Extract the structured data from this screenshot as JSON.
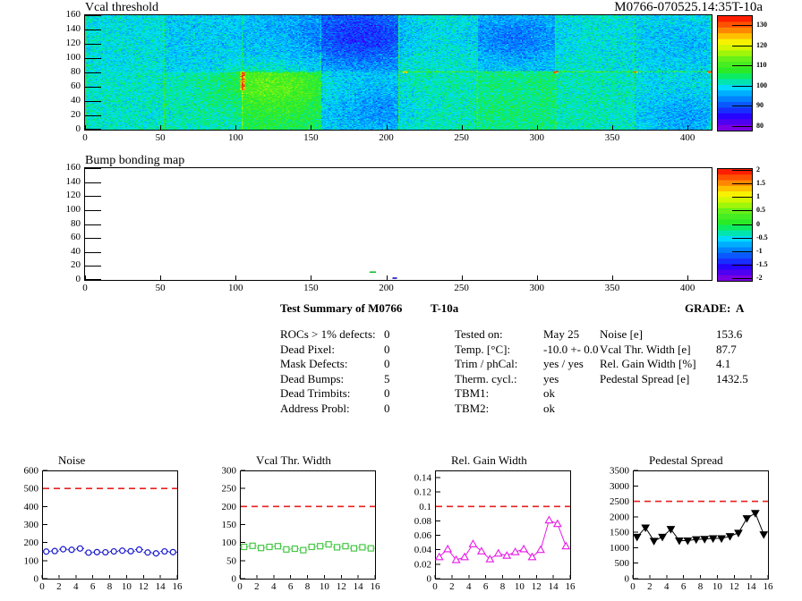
{
  "summary": {
    "title": "Test Summary of M0766",
    "module_type": "T-10a",
    "grade": "GRADE:  A",
    "columns": [
      {
        "rows": [
          [
            "ROCs > 1% defects:",
            "0"
          ],
          [
            "Dead Pixel:",
            "0"
          ],
          [
            "Mask Defects:",
            "0"
          ],
          [
            "Dead Bumps:",
            "5"
          ],
          [
            "Dead Trimbits:",
            "0"
          ],
          [
            "Address Probl:",
            "0"
          ]
        ]
      },
      {
        "rows": [
          [
            "Tested on:",
            "May 25"
          ],
          [
            "Temp. [°C]:",
            "-10.0 +- 0.0"
          ],
          [
            "Trim / phCal:",
            "yes / yes"
          ],
          [
            "Therm. cycl.:",
            "yes"
          ],
          [
            "TBM1:",
            "ok"
          ],
          [
            "TBM2:",
            "ok"
          ]
        ]
      },
      {
        "rows": [
          [
            "Noise [e]",
            "153.6"
          ],
          [
            "Vcal Thr. Width [e]",
            "87.7"
          ],
          [
            "Rel. Gain Width [%]",
            "4.1"
          ],
          [
            "Pedestal Spread [e]",
            "1432.5"
          ]
        ]
      }
    ]
  },
  "colors": {
    "cut": "#e62020",
    "frame": "#000000"
  },
  "chart_data": [
    {
      "type": "heatmap",
      "title": "Vcal threshold",
      "right_title": "M0766-070525.14:35T-10a",
      "x_ticks": [
        0,
        50,
        100,
        150,
        200,
        250,
        300,
        350,
        400
      ],
      "y_ticks": [
        0,
        20,
        40,
        60,
        80,
        100,
        120,
        140,
        160
      ],
      "x_max": 416,
      "y_max": 160,
      "z_labels": [
        "130",
        "120",
        "110",
        "100",
        "90",
        "80"
      ],
      "z_label_values": [
        130,
        120,
        110,
        100,
        90,
        80
      ],
      "z_scale": [
        78,
        135
      ],
      "base": 102,
      "sigma": 3.6,
      "roc_bias_top": [
        -2,
        -4,
        -5,
        -7,
        -1,
        -4,
        -1,
        -2
      ],
      "roc_bias_bottom": [
        -1,
        0,
        4,
        -4,
        0,
        2,
        0,
        -2
      ],
      "blobs": [
        {
          "x": 182,
          "y": 132,
          "r": 26,
          "a": -8
        },
        {
          "x": 285,
          "y": 128,
          "r": 22,
          "a": -6
        },
        {
          "x": 122,
          "y": 62,
          "r": 24,
          "a": 7
        },
        {
          "x": 398,
          "y": 18,
          "r": 22,
          "a": -5
        },
        {
          "x": 196,
          "y": 28,
          "r": 20,
          "a": -4
        },
        {
          "x": 395,
          "y": 120,
          "r": 30,
          "a": -3
        }
      ],
      "v_lines": [
        0,
        52,
        104,
        156,
        208,
        260,
        312,
        364,
        415
      ],
      "v_line_amp": 7,
      "h_line_y": 80,
      "h_line_x1": 100,
      "h_line_amp": 9,
      "red_spots": [
        {
          "x": 104,
          "y1": 55,
          "y2": 80,
          "a": 22
        },
        {
          "x": 212,
          "y1": 79,
          "y2": 81,
          "a": 24
        },
        {
          "x": 312,
          "y1": 79,
          "y2": 81,
          "a": 24
        },
        {
          "x": 365,
          "y1": 79,
          "y2": 81,
          "a": 22
        },
        {
          "x": 414,
          "y1": 79,
          "y2": 81,
          "a": 26
        }
      ]
    },
    {
      "type": "heatmap",
      "title": "Bump bonding map",
      "x_ticks": [
        0,
        50,
        100,
        150,
        200,
        250,
        300,
        350,
        400
      ],
      "y_ticks": [
        0,
        20,
        40,
        60,
        80,
        100,
        120,
        140,
        160
      ],
      "x_max": 416,
      "y_max": 160,
      "z_labels": [
        "2",
        "1.5",
        "1",
        "0.5",
        "0",
        "-0.5",
        "-1",
        "-1.5",
        "-2"
      ],
      "z_label_values": [
        2,
        1.5,
        1,
        0.5,
        0,
        -0.5,
        -1,
        -1.5,
        -2
      ],
      "z_scale": [
        -2.05,
        2.05
      ],
      "background": "#ffffff",
      "points": [
        {
          "x": 189,
          "y": 10,
          "color": "#00bb22",
          "w": 4,
          "h": 2
        },
        {
          "x": 204,
          "y": 1,
          "color": "#4040cc",
          "w": 3,
          "h": 3
        }
      ]
    },
    {
      "type": "scatter",
      "title": "Noise",
      "x": [
        0.5,
        1.5,
        2.5,
        3.5,
        4.5,
        5.5,
        6.5,
        7.5,
        8.5,
        9.5,
        10.5,
        11.5,
        12.5,
        13.5,
        14.5,
        15.5
      ],
      "y": [
        150,
        153,
        163,
        160,
        167,
        144,
        147,
        146,
        151,
        155,
        152,
        161,
        145,
        140,
        151,
        147
      ],
      "y_err": 12,
      "cut": 500,
      "ylim": [
        0,
        600
      ],
      "y_ticks": [
        0,
        100,
        200,
        300,
        400,
        500,
        600
      ],
      "y_tick_labels": [
        "0",
        "100",
        "200",
        "300",
        "400",
        "500",
        "600"
      ],
      "x_ticks": [
        0,
        2,
        4,
        6,
        8,
        10,
        12,
        14,
        16
      ],
      "x_tick_labels": [
        "0",
        "2",
        "4",
        "6",
        "8",
        "10",
        "12",
        "14",
        "16"
      ],
      "marker": "circle",
      "connect": false,
      "xerr": true,
      "color": "#1818cc"
    },
    {
      "type": "scatter",
      "title": "Vcal Thr. Width",
      "x": [
        0.5,
        1.5,
        2.5,
        3.5,
        4.5,
        5.5,
        6.5,
        7.5,
        8.5,
        9.5,
        10.5,
        11.5,
        12.5,
        13.5,
        14.5,
        15.5
      ],
      "y": [
        88,
        91,
        85,
        88,
        90,
        81,
        83,
        79,
        88,
        90,
        95,
        87,
        90,
        84,
        87,
        84
      ],
      "cut": 200,
      "ylim": [
        0,
        300
      ],
      "y_ticks": [
        0,
        50,
        100,
        150,
        200,
        250,
        300
      ],
      "y_tick_labels": [
        "0",
        "50",
        "100",
        "150",
        "200",
        "250",
        "300"
      ],
      "x_ticks": [
        0,
        2,
        4,
        6,
        8,
        10,
        12,
        14,
        16
      ],
      "x_tick_labels": [
        "0",
        "2",
        "4",
        "6",
        "8",
        "10",
        "12",
        "14",
        "16"
      ],
      "marker": "square",
      "connect": false,
      "xerr": true,
      "color": "#46c846"
    },
    {
      "type": "line",
      "title": "Rel. Gain Width",
      "x": [
        0.5,
        1.5,
        2.5,
        3.5,
        4.5,
        5.5,
        6.5,
        7.5,
        8.5,
        9.5,
        10.5,
        11.5,
        12.5,
        13.5,
        14.5,
        15.5
      ],
      "y": [
        0.03,
        0.041,
        0.026,
        0.03,
        0.048,
        0.038,
        0.027,
        0.035,
        0.032,
        0.037,
        0.041,
        0.03,
        0.04,
        0.081,
        0.076,
        0.045
      ],
      "cut": 0.1,
      "ylim": [
        0,
        0.15
      ],
      "y_ticks": [
        0,
        0.02,
        0.04,
        0.06,
        0.08,
        0.1,
        0.12,
        0.14
      ],
      "y_tick_labels": [
        "0",
        "0.02",
        "0.04",
        "0.06",
        "0.08",
        "0.1",
        "0.12",
        "0.14"
      ],
      "x_ticks": [
        0,
        2,
        4,
        6,
        8,
        10,
        12,
        14,
        16
      ],
      "x_tick_labels": [
        "0",
        "2",
        "4",
        "6",
        "8",
        "10",
        "12",
        "14",
        "16"
      ],
      "marker": "triangle",
      "connect": true,
      "color": "#e61ae6"
    },
    {
      "type": "line",
      "title": "Pedestal Spread",
      "x": [
        0.5,
        1.5,
        2.5,
        3.5,
        4.5,
        5.5,
        6.5,
        7.5,
        8.5,
        9.5,
        10.5,
        11.5,
        12.5,
        13.5,
        14.5,
        15.5
      ],
      "y": [
        1350,
        1650,
        1220,
        1350,
        1600,
        1230,
        1230,
        1270,
        1280,
        1300,
        1300,
        1370,
        1480,
        1950,
        2120,
        1430
      ],
      "cut": 2500,
      "ylim": [
        0,
        3500
      ],
      "y_ticks": [
        0,
        500,
        1000,
        1500,
        2000,
        2500,
        3000,
        3500
      ],
      "y_tick_labels": [
        "0",
        "500",
        "1000",
        "1500",
        "2000",
        "2500",
        "3000",
        "3500"
      ],
      "x_ticks": [
        0,
        2,
        4,
        6,
        8,
        10,
        12,
        14,
        16
      ],
      "x_tick_labels": [
        "0",
        "2",
        "4",
        "6",
        "8",
        "10",
        "12",
        "14",
        "16"
      ],
      "marker": "triangle-down",
      "connect": true,
      "color": "#000000"
    }
  ]
}
